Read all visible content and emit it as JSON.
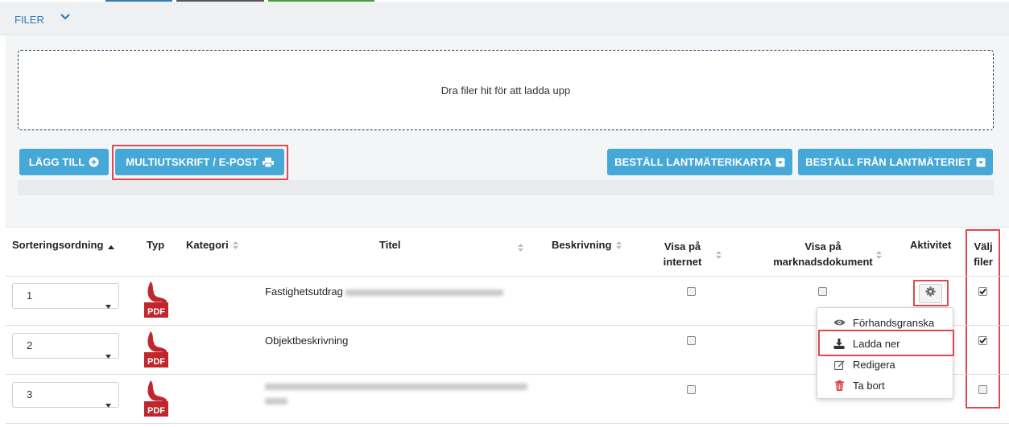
{
  "header": {
    "title": "FILER"
  },
  "dropzone": {
    "text": "Dra filer hit för att ladda upp"
  },
  "toolbar": {
    "add_label": "LÄGG TILL",
    "multiprint_label": "MULTIUTSKRIFT / E-POST",
    "order_map_label": "BESTÄLL LANTMÄTERIKARTA",
    "order_from_label": "BESTÄLL FRÅN LANTMÄTERIET"
  },
  "table": {
    "headers": {
      "sort": "Sorteringsordning",
      "type": "Typ",
      "category": "Kategori",
      "title": "Titel",
      "description": "Beskrivning",
      "internet_1": "Visa på",
      "internet_2": "internet",
      "marketing_1": "Visa på",
      "marketing_2": "marknadsdokument",
      "activity": "Aktivitet",
      "select_1": "Välj",
      "select_2": "filer"
    },
    "rows": [
      {
        "order": "1",
        "type": "PDF",
        "title": "Fastighetsutdrag",
        "internet": false,
        "marketing": false,
        "selected": true
      },
      {
        "order": "2",
        "type": "PDF",
        "title": "Objektbeskrivning",
        "internet": false,
        "marketing": false,
        "selected": true
      },
      {
        "order": "3",
        "type": "PDF",
        "title": "",
        "internet": false,
        "marketing": false,
        "selected": false
      }
    ]
  },
  "context_menu": {
    "items": [
      {
        "label": "Förhandsgranska",
        "icon": "eye-icon"
      },
      {
        "label": "Ladda ner",
        "icon": "download-icon"
      },
      {
        "label": "Redigera",
        "icon": "edit-icon"
      },
      {
        "label": "Ta bort",
        "icon": "trash-icon"
      }
    ]
  },
  "colors": {
    "accent": "#45a8d6",
    "link": "#2f7dbb",
    "highlight_border": "#e0484d",
    "pdf_red": "#c0262c"
  }
}
